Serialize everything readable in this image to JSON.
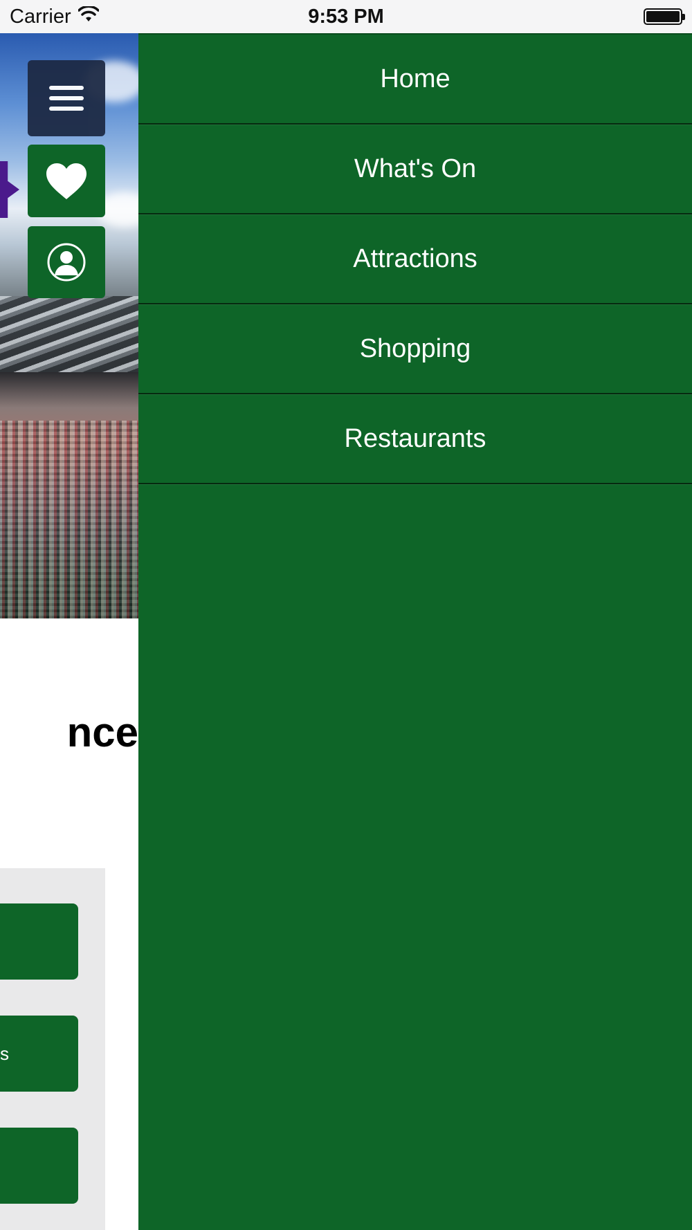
{
  "status_bar": {
    "carrier": "Carrier",
    "time": "9:53 PM",
    "wifi_icon": "wifi-icon",
    "battery_icon": "battery-icon"
  },
  "side_buttons": {
    "menu_icon": "hamburger-menu-icon",
    "favorites_icon": "heart-icon",
    "profile_icon": "user-profile-icon"
  },
  "page": {
    "heading_fragment": "nce",
    "card_2_text_fragment": "s"
  },
  "drawer": {
    "items": [
      {
        "label": "Home"
      },
      {
        "label": "What's On"
      },
      {
        "label": "Attractions"
      },
      {
        "label": "Shopping"
      },
      {
        "label": "Restaurants"
      }
    ]
  },
  "colors": {
    "brand_green": "#0e6528",
    "menu_button_navy": "#1d2a45",
    "panel_grey": "#e9e9ea"
  }
}
